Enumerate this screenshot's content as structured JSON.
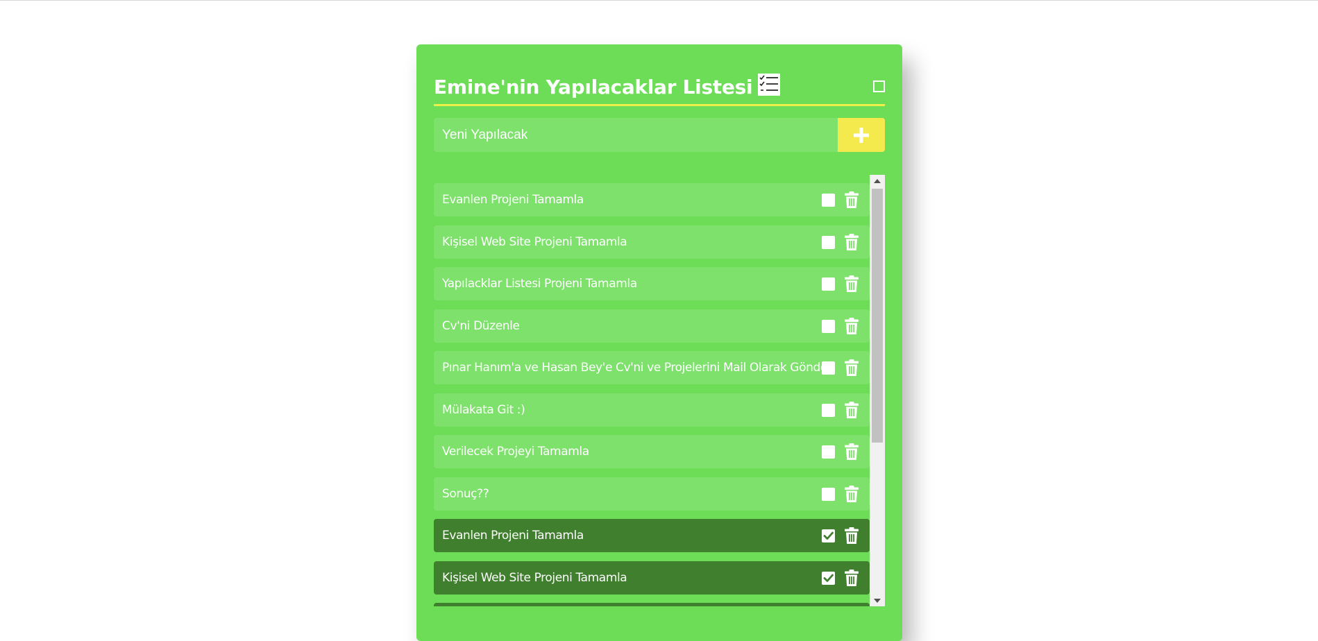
{
  "header": {
    "title": "Emine'nin Yapılacaklar Listesi",
    "title_icon": "checklist-icon",
    "box_icon": "square-outline-icon"
  },
  "new_todo": {
    "placeholder": "Yeni Yapılacak",
    "add_icon": "plus-icon"
  },
  "colors": {
    "card": "#6ddc56",
    "item": "#7de16b",
    "item_done": "#3f7f2d",
    "accent_yellow": "#f4ea4d",
    "underline": "#eef04a"
  },
  "todos": [
    {
      "text": "Evanlen Projeni Tamamla",
      "done": false
    },
    {
      "text": "Kişisel Web Site Projeni Tamamla",
      "done": false
    },
    {
      "text": "Yapılacklar Listesi Projeni Tamamla",
      "done": false
    },
    {
      "text": "Cv'ni Düzenle",
      "done": false
    },
    {
      "text": "Pınar Hanım'a ve Hasan Bey'e Cv'ni ve Projelerini Mail Olarak Gönder",
      "done": false
    },
    {
      "text": "Mülakata Git :)",
      "done": false
    },
    {
      "text": "Verilecek Projeyi Tamamla",
      "done": false
    },
    {
      "text": "Sonuç??",
      "done": false
    },
    {
      "text": "Evanlen Projeni Tamamla",
      "done": true
    },
    {
      "text": "Kişisel Web Site Projeni Tamamla",
      "done": true
    },
    {
      "text": "",
      "done": true
    }
  ]
}
